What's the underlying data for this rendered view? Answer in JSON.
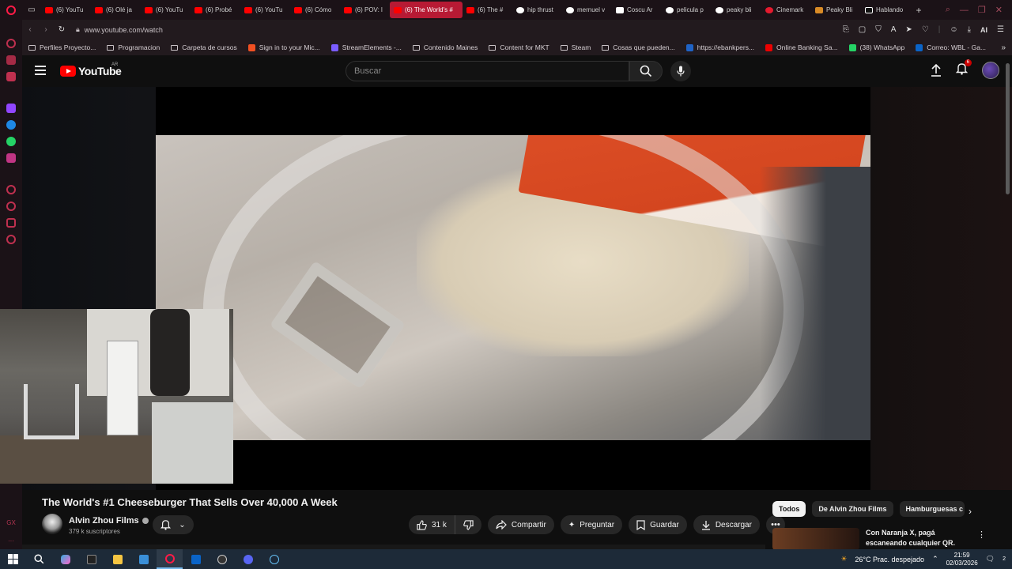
{
  "browser": {
    "tabs": [
      {
        "label": "(6) YouTu",
        "favicon": "youtube-icon",
        "active": false
      },
      {
        "label": "(6) Olé ja",
        "favicon": "youtube-icon",
        "active": false
      },
      {
        "label": "(6) YouTu",
        "favicon": "youtube-icon",
        "active": false
      },
      {
        "label": "(6) Probé",
        "favicon": "youtube-icon",
        "active": false
      },
      {
        "label": "(6) YouTu",
        "favicon": "youtube-icon",
        "active": false
      },
      {
        "label": "(6) Cómo",
        "favicon": "youtube-icon",
        "active": false
      },
      {
        "label": "(6) POV: l",
        "favicon": "youtube-icon",
        "active": false
      },
      {
        "label": "(6) The World's #",
        "favicon": "youtube-icon",
        "active": true
      },
      {
        "label": "(6) The #",
        "favicon": "youtube-icon",
        "active": false
      },
      {
        "label": "hip thrust",
        "favicon": "google-icon",
        "active": false
      },
      {
        "label": "mernuel v",
        "favicon": "google-icon",
        "active": false
      },
      {
        "label": "Coscu Ar",
        "favicon": "wikipedia-icon",
        "active": false
      },
      {
        "label": "pelicula p",
        "favicon": "google-icon",
        "active": false
      },
      {
        "label": "peaky bli",
        "favicon": "google-icon",
        "active": false
      },
      {
        "label": "Cinemark",
        "favicon": "cinemark-icon",
        "active": false
      },
      {
        "label": "Peaky Bli",
        "favicon": "imdb-icon",
        "active": false
      },
      {
        "label": "Hablando",
        "favicon": "tiktok-icon",
        "active": false
      }
    ],
    "url": "www.youtube.com/watch",
    "ai_label": "AI",
    "bookmarks": [
      {
        "label": "Perfiles Proyecto...",
        "icon": "folder-icon"
      },
      {
        "label": "Programacion",
        "icon": "folder-icon"
      },
      {
        "label": "Carpeta de cursos",
        "icon": "folder-icon"
      },
      {
        "label": "Sign in to your Mic...",
        "icon": "microsoft-icon"
      },
      {
        "label": "StreamElements -...",
        "icon": "streamelements-icon"
      },
      {
        "label": "Contenido Maines",
        "icon": "folder-icon"
      },
      {
        "label": "Content for MKT",
        "icon": "folder-icon"
      },
      {
        "label": "Steam",
        "icon": "folder-icon"
      },
      {
        "label": "Cosas que pueden...",
        "icon": "folder-icon"
      },
      {
        "label": "https://ebankpers...",
        "icon": "bank-icon"
      },
      {
        "label": "Online Banking Sa...",
        "icon": "santander-icon"
      },
      {
        "label": "(38) WhatsApp",
        "icon": "whatsapp-icon"
      },
      {
        "label": "Correo: WBL - Ga...",
        "icon": "outlook-icon"
      }
    ]
  },
  "youtube": {
    "logo_text": "YouTube",
    "country_code": "AR",
    "search_placeholder": "Buscar",
    "notification_count": "6",
    "video": {
      "title": "The World's #1 Cheeseburger That Sells Over 40,000 A Week",
      "channel_name": "Alvin Zhou Films",
      "subscribers": "379 k suscriptores",
      "likes": "31 k",
      "share_label": "Compartir",
      "ask_label": "Preguntar",
      "save_label": "Guardar",
      "download_label": "Descargar"
    },
    "chips": [
      "Todos",
      "De Alvin Zhou Films",
      "Hamburguesas c"
    ],
    "recommendation": {
      "title_line1": "Con Naranja X, pagá",
      "title_line2": "escaneando cualquier QR."
    }
  },
  "taskbar": {
    "weather": "26°C  Prac. despejado",
    "time": "21:59",
    "date": "02/03/2026",
    "notifications": "2"
  },
  "colors": {
    "youtube_red": "#ff0000",
    "opera_red": "#ff1b47",
    "active_tab": "#b71a34"
  }
}
